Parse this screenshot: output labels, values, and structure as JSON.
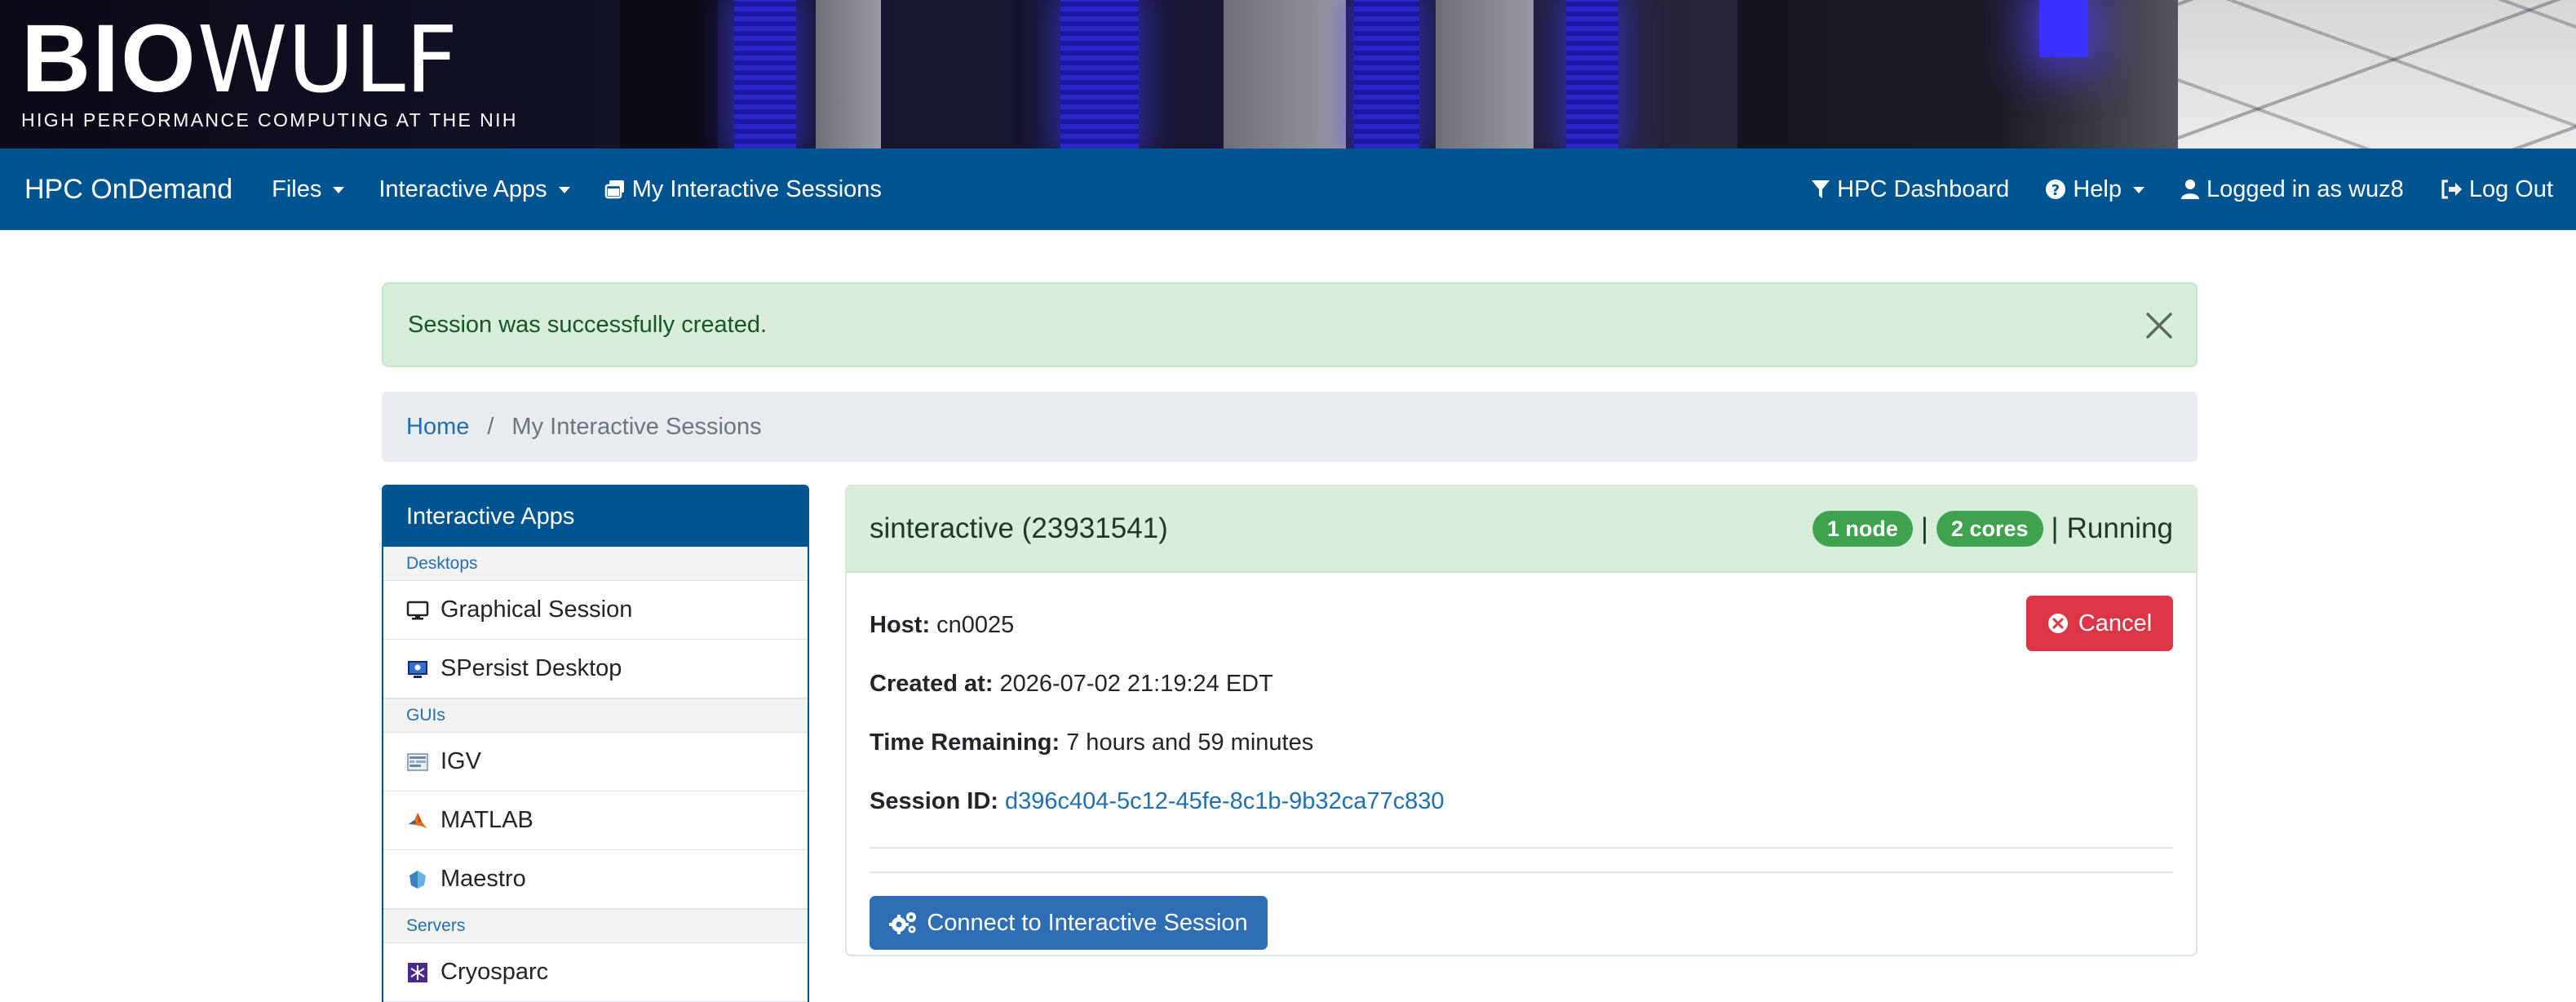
{
  "banner": {
    "logo_bold": "BIO",
    "logo_light": "WULF",
    "tagline": "High Performance Computing at the NIH"
  },
  "navbar": {
    "brand": "HPC OnDemand",
    "files": "Files",
    "interactive_apps": "Interactive Apps",
    "my_sessions": "My Interactive Sessions",
    "dashboard": "HPC Dashboard",
    "help": "Help",
    "logged_in": "Logged in as wuz8",
    "logout": "Log Out",
    "background": "#00548f"
  },
  "alert": {
    "message": "Session was successfully created."
  },
  "breadcrumb": {
    "home": "Home",
    "separator": "/",
    "current": "My Interactive Sessions"
  },
  "sidebar": {
    "title": "Interactive Apps",
    "categories": {
      "desktops": "Desktops",
      "guis": "GUIs",
      "servers": "Servers"
    },
    "items": {
      "graphical": "Graphical Session",
      "spersist": "SPersist Desktop",
      "igv": "IGV",
      "matlab": "MATLAB",
      "maestro": "Maestro",
      "cryosparc": "Cryosparc"
    }
  },
  "session": {
    "title": "sinteractive (23931541)",
    "nodes_badge": "1 node",
    "cores_badge": "2 cores",
    "separator": "|",
    "status": "Running",
    "host_label": "Host:",
    "host_value": "cn0025",
    "created_label": "Created at:",
    "created_value": "2026-07-02 21:19:24 EDT",
    "remaining_label": "Time Remaining:",
    "remaining_value": "7 hours and 59 minutes",
    "id_label": "Session ID:",
    "id_value": "d396c404-5c12-45fe-8c1b-9b32ca77c830",
    "cancel_label": "Cancel",
    "connect_label": "Connect to Interactive Session",
    "colors": {
      "badge": "#3fa34d",
      "cancel": "#dc3545",
      "connect": "#2f6db4",
      "header": "#d8edda"
    }
  }
}
